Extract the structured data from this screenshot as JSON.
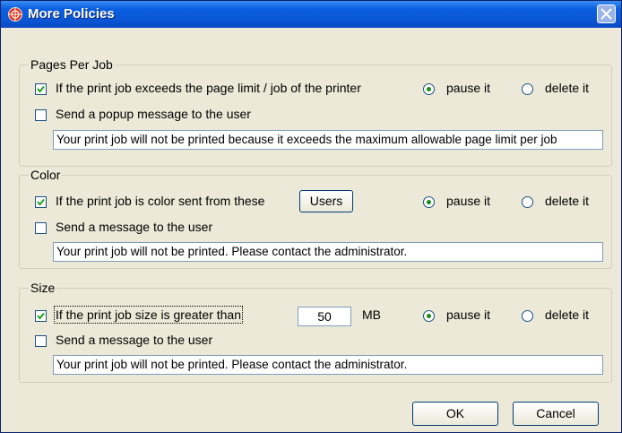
{
  "window": {
    "title": "More Policies"
  },
  "pages_per_job": {
    "legend": "Pages Per Job",
    "exceed_checkbox": {
      "label": "If the print job exceeds the page limit / job of the printer",
      "checked": true
    },
    "pause_option": {
      "label": "pause it",
      "selected": true
    },
    "delete_option": {
      "label": "delete it",
      "selected": false
    },
    "popup_checkbox": {
      "label": "Send a popup message to the user",
      "checked": false
    },
    "message": "Your print job will not be printed because it exceeds the maximum allowable page limit per job"
  },
  "color": {
    "legend": "Color",
    "color_checkbox": {
      "label": "If the print job is color sent from these",
      "checked": true
    },
    "users_button": "Users",
    "pause_option": {
      "label": "pause it",
      "selected": true
    },
    "delete_option": {
      "label": "delete it",
      "selected": false
    },
    "message_checkbox": {
      "label": "Send a message to the user",
      "checked": false
    },
    "message": "Your print job will not be printed.  Please contact the administrator."
  },
  "size": {
    "legend": "Size",
    "size_checkbox": {
      "label": "If the print job size is greater than",
      "checked": true
    },
    "size_value": "50",
    "unit": "MB",
    "pause_option": {
      "label": "pause it",
      "selected": true
    },
    "delete_option": {
      "label": "delete it",
      "selected": false
    },
    "message_checkbox": {
      "label": "Send a message to the user",
      "checked": false
    },
    "message": "Your print job will not be printed.  Please contact the administrator."
  },
  "buttons": {
    "ok": "OK",
    "cancel": "Cancel"
  },
  "colors": {
    "titlebar": "#0b57d6",
    "dialog_bg": "#ece9d8",
    "radio_dot": "#1a8c1a",
    "check_mark": "#21a121"
  }
}
